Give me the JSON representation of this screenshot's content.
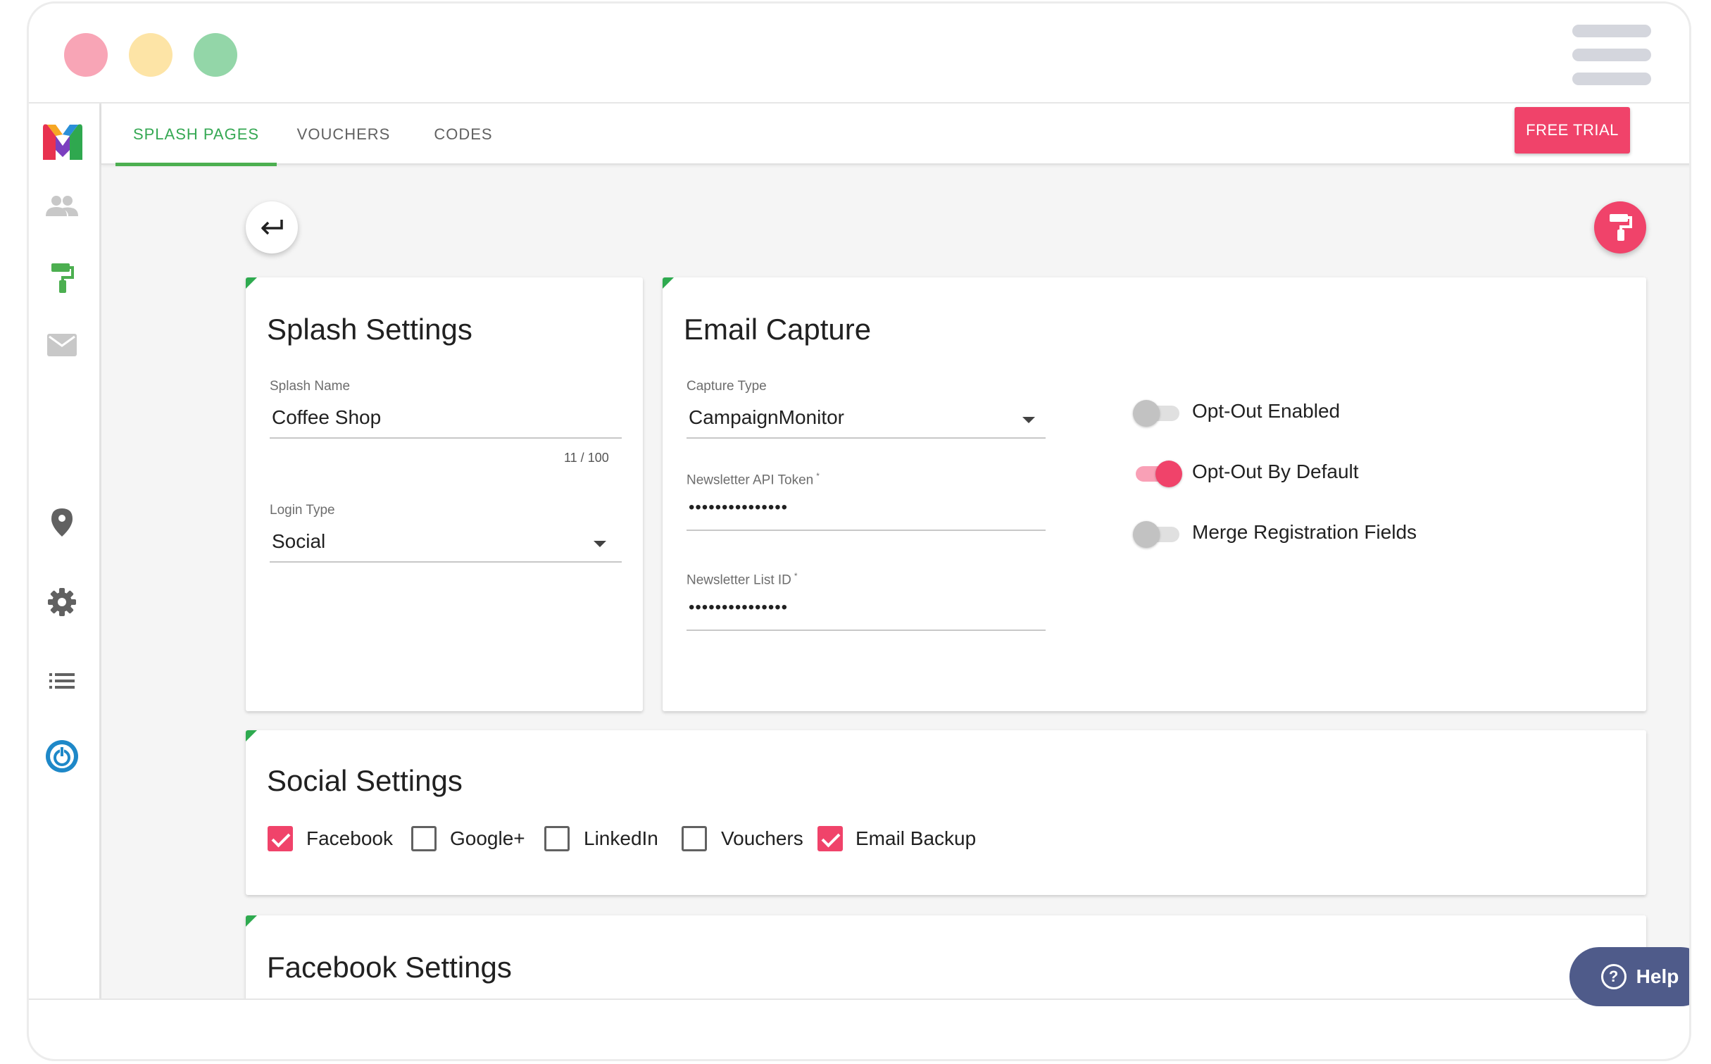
{
  "window": {
    "controls": [
      "close",
      "minimize",
      "maximize"
    ],
    "menu_icon": "hamburger-icon"
  },
  "sidebar": {
    "logo": "M",
    "items": [
      {
        "icon": "people-icon",
        "active": false
      },
      {
        "icon": "paint-roller-icon",
        "active": true
      },
      {
        "icon": "mail-icon",
        "active": false
      },
      {
        "icon": "location-pin-icon",
        "active": false
      },
      {
        "icon": "gear-icon",
        "active": false
      },
      {
        "icon": "list-icon",
        "active": false
      },
      {
        "icon": "power-icon",
        "active": false
      }
    ]
  },
  "tabs": [
    {
      "label": "SPLASH PAGES",
      "active": true
    },
    {
      "label": "VOUCHERS",
      "active": false
    },
    {
      "label": "CODES",
      "active": false
    }
  ],
  "header": {
    "free_trial": "FREE TRIAL"
  },
  "actions": {
    "back_icon": "back-arrow-icon",
    "design_icon": "paint-roller-icon"
  },
  "splash_settings": {
    "title": "Splash Settings",
    "splash_name_label": "Splash Name",
    "splash_name_value": "Coffee Shop",
    "splash_name_counter": "11 / 100",
    "login_type_label": "Login Type",
    "login_type_value": "Social"
  },
  "email_capture": {
    "title": "Email Capture",
    "capture_type_label": "Capture Type",
    "capture_type_value": "CampaignMonitor",
    "api_token_label": "Newsletter API Token",
    "api_token_value": "•••••••••••••••",
    "list_id_label": "Newsletter List ID",
    "list_id_value": "•••••••••••••••",
    "required_mark": "*",
    "toggles": [
      {
        "label": "Opt-Out Enabled",
        "on": false
      },
      {
        "label": "Opt-Out By Default",
        "on": true
      },
      {
        "label": "Merge Registration Fields",
        "on": false
      }
    ]
  },
  "social_settings": {
    "title": "Social Settings",
    "options": [
      {
        "label": "Facebook",
        "checked": true
      },
      {
        "label": "Google+",
        "checked": false
      },
      {
        "label": "LinkedIn",
        "checked": false
      },
      {
        "label": "Vouchers",
        "checked": false
      },
      {
        "label": "Email Backup",
        "checked": true
      }
    ]
  },
  "facebook_settings": {
    "title": "Facebook Settings"
  },
  "help": {
    "label": "Help"
  },
  "colors": {
    "accent_pink": "#f0436a",
    "accent_green": "#4caf50",
    "help_blue": "#4f5b8a"
  }
}
